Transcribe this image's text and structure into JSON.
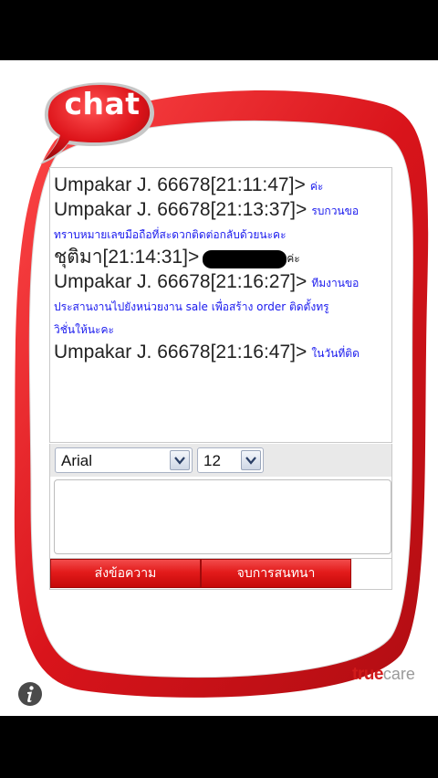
{
  "logo": {
    "text": "chat"
  },
  "transcript": {
    "messages": [
      {
        "sender": "Umpakar J. 66678[21:11:47]>",
        "text": "ค่ะ"
      },
      {
        "sender": "Umpakar J. 66678[21:13:37]>",
        "text": "รบกวนขอ",
        "continuation": "ทราบหมายเลขมือถือที่สะดวกติดต่อกลับด้วยนะคะ"
      },
      {
        "sender": "ชุติมา[21:14:31]>",
        "text": "ค่ะ"
      },
      {
        "sender": "Umpakar J. 66678[21:16:27]>",
        "text": "ทีมงานขอ",
        "continuation1": "ประสานงานไปยังหน่วยงาน sale เพื่อสร้าง order ติดตั้งทรู",
        "continuation2": "วิชั่นให้นะคะ"
      },
      {
        "sender": "Umpakar J. 66678[21:16:47]>",
        "text": "ในวันที่ติด"
      }
    ]
  },
  "toolbar": {
    "font_value": "Arial",
    "size_value": "12"
  },
  "buttons": {
    "send_label": "ส่งข้อความ",
    "end_label": "จบการสนทนา"
  },
  "brand": {
    "true_text": "true",
    "care_text": "care"
  },
  "colors": {
    "frame_red": "#d9141b",
    "message_blue": "#1a1aee",
    "background": "#000000"
  }
}
